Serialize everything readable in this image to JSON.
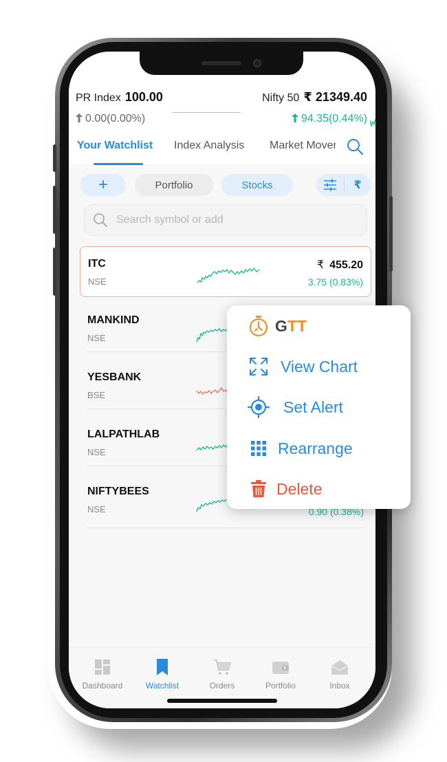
{
  "header": {
    "pr_index": {
      "label": "PR Index",
      "value": "100.00",
      "change": "0.00(0.00%)"
    },
    "nifty": {
      "label": "Nifty 50",
      "currency": "₹",
      "value": "21349.40",
      "change": "94.35(0.44%)"
    }
  },
  "tabs": [
    {
      "label": "Your Watchlist"
    },
    {
      "label": "Index Analysis"
    },
    {
      "label": "Market Movers"
    }
  ],
  "chips": {
    "add": "+",
    "portfolio": "Portfolio",
    "stocks": "Stocks",
    "rupee": "₹"
  },
  "search": {
    "placeholder": "Search symbol or add"
  },
  "watchlist": [
    {
      "symbol": "ITC",
      "exchange": "NSE",
      "currency": "₹",
      "price": "455.20",
      "change": "3.75 (0.83%)"
    },
    {
      "symbol": "MANKIND",
      "exchange": "NSE"
    },
    {
      "symbol": "YESBANK",
      "exchange": "BSE"
    },
    {
      "symbol": "LALPATHLAB",
      "exchange": "NSE"
    },
    {
      "symbol": "NIFTYBEES",
      "exchange": "NSE",
      "change": "0.90 (0.38%)"
    }
  ],
  "menu": {
    "gtt_g": "G",
    "gtt_t": "TT",
    "view_chart": "View Chart",
    "set_alert": "Set Alert",
    "rearrange": "Rearrange",
    "delete": "Delete"
  },
  "bottom_nav": [
    {
      "label": "Dashboard"
    },
    {
      "label": "Watchlist"
    },
    {
      "label": "Orders"
    },
    {
      "label": "Portfolio"
    },
    {
      "label": "Inbox"
    }
  ],
  "colors": {
    "accent": "#2a8bd8",
    "positive": "#1ab394",
    "negative": "#e8735a",
    "gtt": "#f28c28",
    "delete": "#e8573a"
  },
  "icons": [
    "arrow-up-icon",
    "search-icon",
    "plus-icon",
    "filter-icon",
    "rupee-icon",
    "gtt-icon",
    "expand-icon",
    "target-icon",
    "grid-icon",
    "trash-icon",
    "dashboard-icon",
    "bookmark-icon",
    "cart-icon",
    "wallet-icon",
    "inbox-icon"
  ]
}
